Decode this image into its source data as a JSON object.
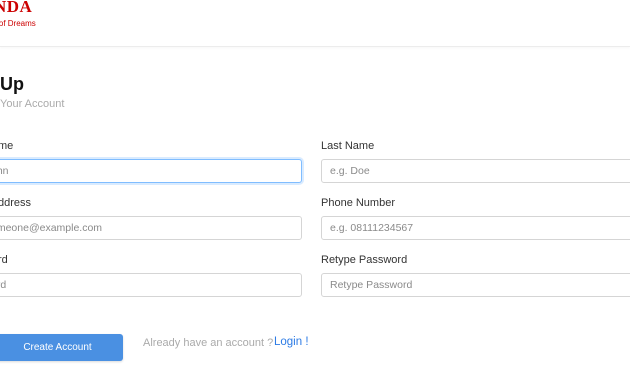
{
  "header": {
    "logo_word": "NDA",
    "logo_tagline": "r of Dreams"
  },
  "page": {
    "title": " Up",
    "subtitle": "Your Account"
  },
  "form": {
    "first_name": {
      "label": "me",
      "placeholder": "ohn"
    },
    "last_name": {
      "label": "Last Name",
      "placeholder": "e.g. Doe"
    },
    "email": {
      "label": "ddress",
      "placeholder": "omeone@example.com"
    },
    "phone": {
      "label": "Phone Number",
      "placeholder": "e.g. 08111234567"
    },
    "password": {
      "label": "rd",
      "placeholder": "ord"
    },
    "retype_password": {
      "label": "Retype Password",
      "placeholder": "Retype Password"
    }
  },
  "actions": {
    "create_account": "Create Account",
    "have_account": "Already have an account ?",
    "login": "Login !"
  },
  "colors": {
    "brand": "#cc0000",
    "button": "#4a90e2",
    "link": "#2c7be5",
    "focus": "#80bdff"
  }
}
